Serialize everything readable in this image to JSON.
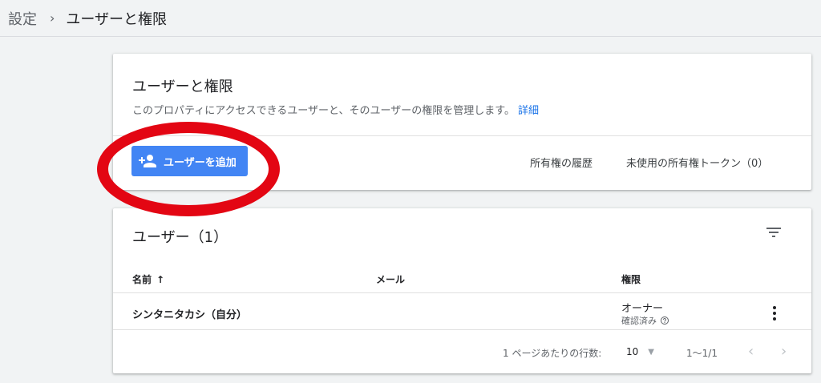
{
  "breadcrumb": {
    "root": "設定",
    "separator": "›",
    "current": "ユーザーと権限"
  },
  "card": {
    "title": "ユーザーと権限",
    "description": "このプロパティにアクセスできるユーザーと、そのユーザーの権限を管理します。",
    "details_link": "詳細",
    "add_user_button": "ユーザーを追加",
    "ownership_history": "所有権の履歴",
    "unused_tokens": "未使用の所有権トークン（0）"
  },
  "users": {
    "header": "ユーザー（1）",
    "columns": {
      "name": "名前",
      "sort_arrow": "↑",
      "email": "メール",
      "permission": "権限"
    },
    "rows": [
      {
        "name": "シンタニタカシ（自分）",
        "email": "",
        "role": "オーナー",
        "status": "確認済み"
      }
    ]
  },
  "pagination": {
    "rows_per_page_label": "1 ページあたりの行数:",
    "rows_per_page_value": "10",
    "range": "1〜1/1",
    "prev": "‹",
    "next": "›"
  },
  "colors": {
    "accent": "#4285f4",
    "link": "#1a73e8",
    "highlight_ring": "#e30613"
  },
  "icons": [
    "person-add-icon",
    "filter-icon",
    "help-icon",
    "more-vert-icon",
    "chevron-left-icon",
    "chevron-right-icon"
  ]
}
